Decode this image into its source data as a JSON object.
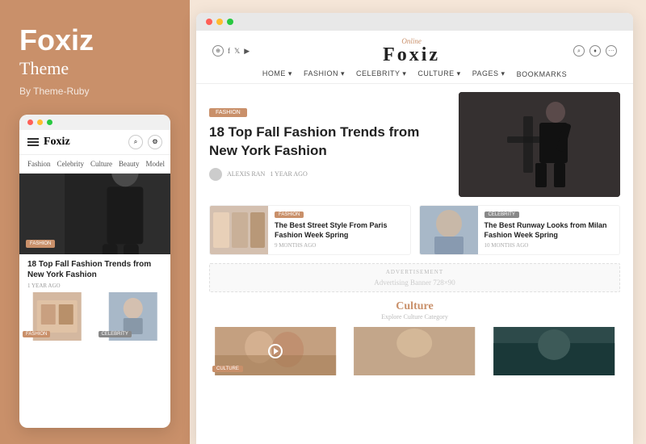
{
  "brand": {
    "name": "Foxiz",
    "subtitle": "Theme",
    "credit": "By Theme-Ruby"
  },
  "mobile": {
    "logo": "Foxiz",
    "nav": [
      "Fashion",
      "Celebrity",
      "Culture",
      "Beauty",
      "Model"
    ],
    "hero_badge": "FASHION",
    "hero_title": "18 Top Fall Fashion Trends from New York Fashion",
    "hero_meta": "1 YEAR AGO",
    "thumb1_badge": "FASHION",
    "thumb2_badge": "CELEBRITY"
  },
  "desktop": {
    "logo_script": "Online",
    "logo_main": "Foxiz",
    "nav_items": [
      "HOME ▾",
      "FASHION ▾",
      "CELEBRITY ▾",
      "CULTURE ▾",
      "PAGES ▾",
      "BOOKMARKS"
    ],
    "hero": {
      "tag": "FASHION",
      "title": "18 Top Fall Fashion Trends from New York Fashion",
      "author": "ALEXIS RAN",
      "time": "1 YEAR AGO"
    },
    "cards": [
      {
        "tag": "FASHION",
        "title": "The Best Street Style From Paris Fashion Week Spring",
        "time": "9 MONTHS AGO"
      },
      {
        "tag": "CELEBRITY",
        "title": "The Best Runway Looks from Milan Fashion Week Spring",
        "time": "10 MONTHS AGO"
      }
    ],
    "ad": {
      "label": "ADVERTISEMENT",
      "content": "Advertising Banner 728×90"
    },
    "culture": {
      "title": "Culture",
      "subtitle": "Explore Culture Category",
      "cards": [
        {
          "badge": "CULTURE"
        },
        {
          "badge": ""
        },
        {
          "badge": ""
        }
      ]
    }
  }
}
